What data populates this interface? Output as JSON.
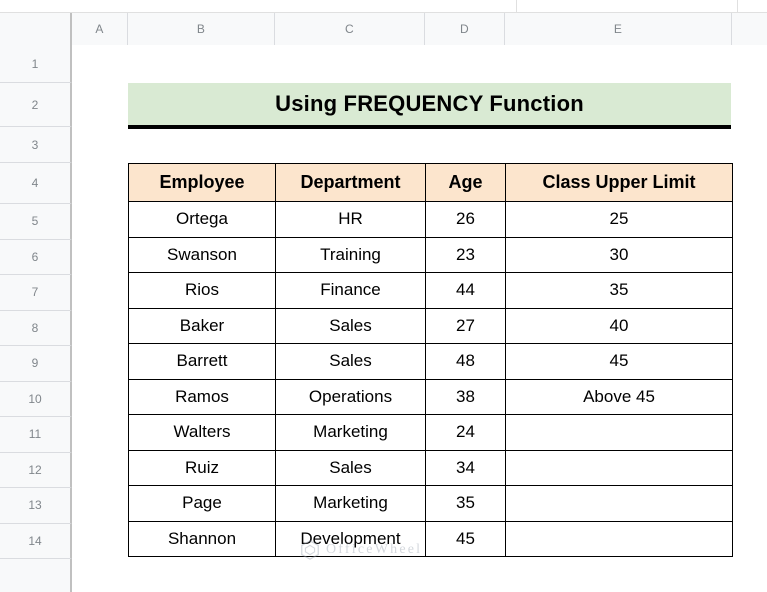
{
  "app": {
    "type": "spreadsheet",
    "column_headers": [
      "A",
      "B",
      "C",
      "D",
      "E"
    ],
    "row_headers": [
      "1",
      "2",
      "3",
      "4",
      "5",
      "6",
      "7",
      "8",
      "9",
      "10",
      "11",
      "12",
      "13",
      "14"
    ]
  },
  "title": {
    "text": "Using FREQUENCY Function",
    "cell": "B2",
    "background_color": "#d9ead3",
    "underline_color": "#000000"
  },
  "table": {
    "header_background": "#fce5cd",
    "border_color": "#000000",
    "columns": [
      "Employee",
      "Department",
      "Age",
      "Class Upper Limit"
    ],
    "rows": [
      {
        "employee": "Ortega",
        "department": "HR",
        "age": "26",
        "class_upper_limit": "25"
      },
      {
        "employee": "Swanson",
        "department": "Training",
        "age": "23",
        "class_upper_limit": "30"
      },
      {
        "employee": "Rios",
        "department": "Finance",
        "age": "44",
        "class_upper_limit": "35"
      },
      {
        "employee": "Baker",
        "department": "Sales",
        "age": "27",
        "class_upper_limit": "40"
      },
      {
        "employee": "Barrett",
        "department": "Sales",
        "age": "48",
        "class_upper_limit": "45"
      },
      {
        "employee": "Ramos",
        "department": "Operations",
        "age": "38",
        "class_upper_limit": "Above 45"
      },
      {
        "employee": "Walters",
        "department": "Marketing",
        "age": "24",
        "class_upper_limit": ""
      },
      {
        "employee": "Ruiz",
        "department": "Sales",
        "age": "34",
        "class_upper_limit": ""
      },
      {
        "employee": "Page",
        "department": "Marketing",
        "age": "35",
        "class_upper_limit": ""
      },
      {
        "employee": "Shannon",
        "department": "Development",
        "age": "45",
        "class_upper_limit": ""
      }
    ]
  },
  "watermark": {
    "text": "OfficeWheel",
    "icon": "hexagon-logo-icon"
  }
}
